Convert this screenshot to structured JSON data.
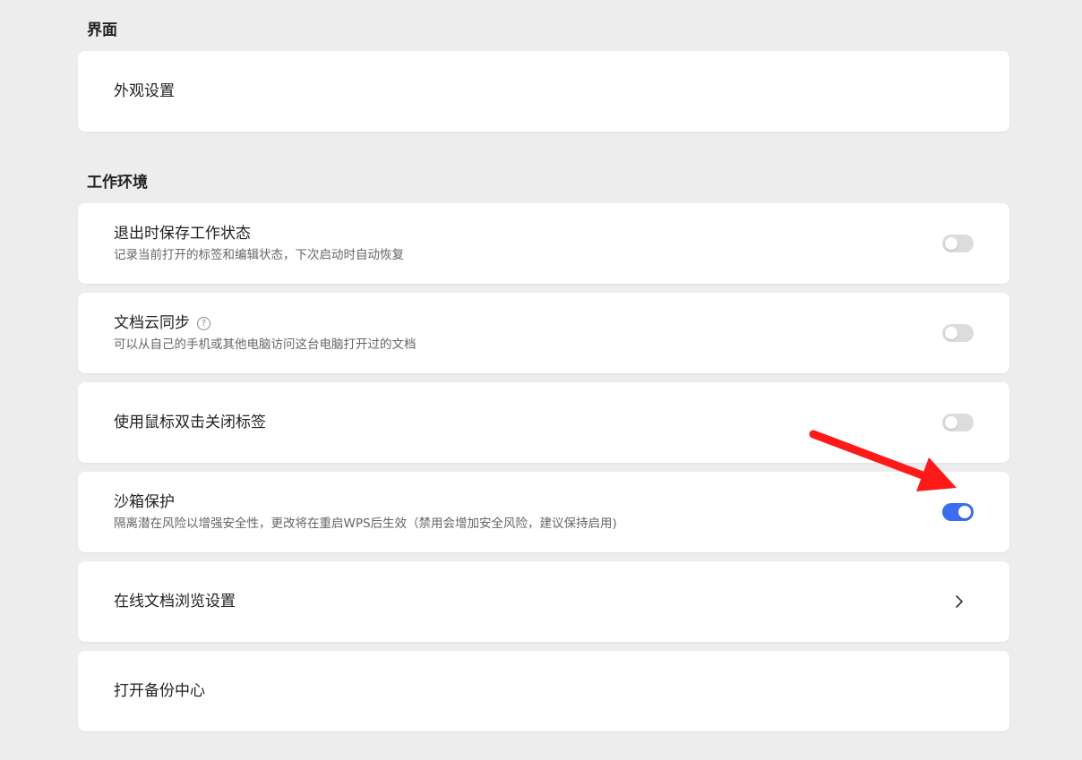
{
  "sections": {
    "appearance": {
      "title": "界面",
      "items": {
        "appearance_settings": {
          "label": "外观设置"
        }
      }
    },
    "workspace": {
      "title": "工作环境",
      "items": {
        "save_state": {
          "label": "退出时保存工作状态",
          "description": "记录当前打开的标签和编辑状态，下次启动时自动恢复",
          "enabled": false
        },
        "cloud_sync": {
          "label": "文档云同步",
          "help_icon": "?",
          "description": "可以从自己的手机或其他电脑访问这台电脑打开过的文档",
          "enabled": false
        },
        "double_click_close": {
          "label": "使用鼠标双击关闭标签",
          "enabled": false
        },
        "sandbox": {
          "label": "沙箱保护",
          "description": "隔离潜在风险以增强安全性，更改将在重启WPS后生效（禁用会增加安全风险，建议保持启用)",
          "enabled": true
        },
        "online_doc_browse": {
          "label": "在线文档浏览设置"
        },
        "backup_center": {
          "label": "打开备份中心"
        }
      }
    }
  },
  "colors": {
    "background": "#ededed",
    "card": "#ffffff",
    "toggle_on": "#3c6df0",
    "toggle_off": "#dcdcdc",
    "annotation_arrow": "#ff1a1a"
  },
  "icons": {
    "help": "question-circle-icon",
    "chevron": "chevron-right-icon",
    "annotation": "red-arrow-annotation"
  }
}
